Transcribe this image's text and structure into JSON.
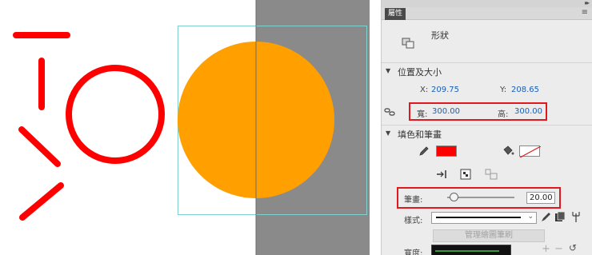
{
  "canvas": {
    "colors": {
      "stroke_red": "#ff0000",
      "circle_orange": "#ff9f00",
      "stage": "#ffffff",
      "pasteboard": "#8a8a8a"
    }
  },
  "panel": {
    "tab_label": "屬性",
    "object_type": "形狀",
    "position_size": {
      "title": "位置及大小",
      "x_label": "X:",
      "x_value": "209.75",
      "y_label": "Y:",
      "y_value": "208.65",
      "w_label": "寬:",
      "w_value": "300.00",
      "h_label": "高:",
      "h_value": "300.00"
    },
    "fill_stroke": {
      "title": "填色和筆畫",
      "stroke_color": "#ff0000",
      "stroke_label": "筆畫:",
      "stroke_width": "20.00",
      "stroke_fraction": 0.1,
      "style_label": "樣式:",
      "manage_brush_label": "管理繪圖筆刷",
      "width_label": "寬度:"
    },
    "icons": [
      "collapse-icon",
      "menu-icon",
      "shape-icon",
      "link-icon",
      "pencil-icon",
      "paint-bucket-icon",
      "cap-icon",
      "join-icon",
      "scale-icon",
      "chevron-down-icon",
      "brush-icon",
      "library-icon",
      "plus-icon",
      "minus-icon",
      "refresh-icon"
    ]
  }
}
